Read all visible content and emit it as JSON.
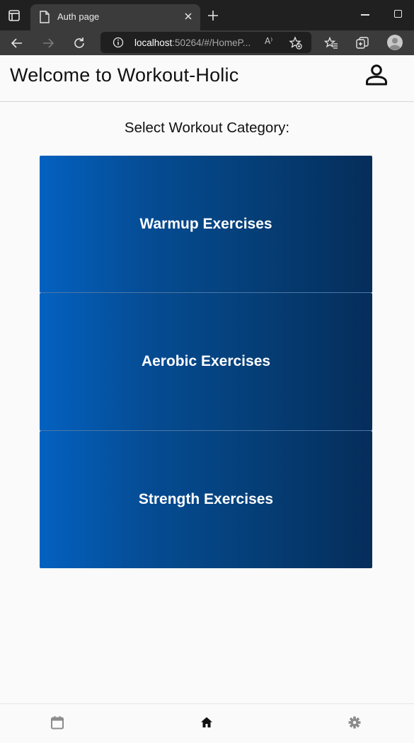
{
  "browser": {
    "tab_title": "Auth page",
    "url_host": "localhost",
    "url_rest": ":50264/#/HomeP...",
    "read_aloud_label": "A⁾"
  },
  "app": {
    "title": "Welcome to Workout-Holic",
    "select_prompt": "Select Workout Category:",
    "categories": [
      {
        "label": "Warmup Exercises"
      },
      {
        "label": "Aerobic Exercises"
      },
      {
        "label": "Strength Exercises"
      }
    ],
    "bottom_nav": [
      {
        "icon": "calendar-icon",
        "active": false
      },
      {
        "icon": "home-icon",
        "active": true
      },
      {
        "icon": "settings-icon",
        "active": false
      }
    ]
  },
  "colors": {
    "card_gradient_start": "#0461c0",
    "card_gradient_end": "#052d5a",
    "chrome_dark": "#202020",
    "chrome_toolbar": "#3b3b3b"
  }
}
